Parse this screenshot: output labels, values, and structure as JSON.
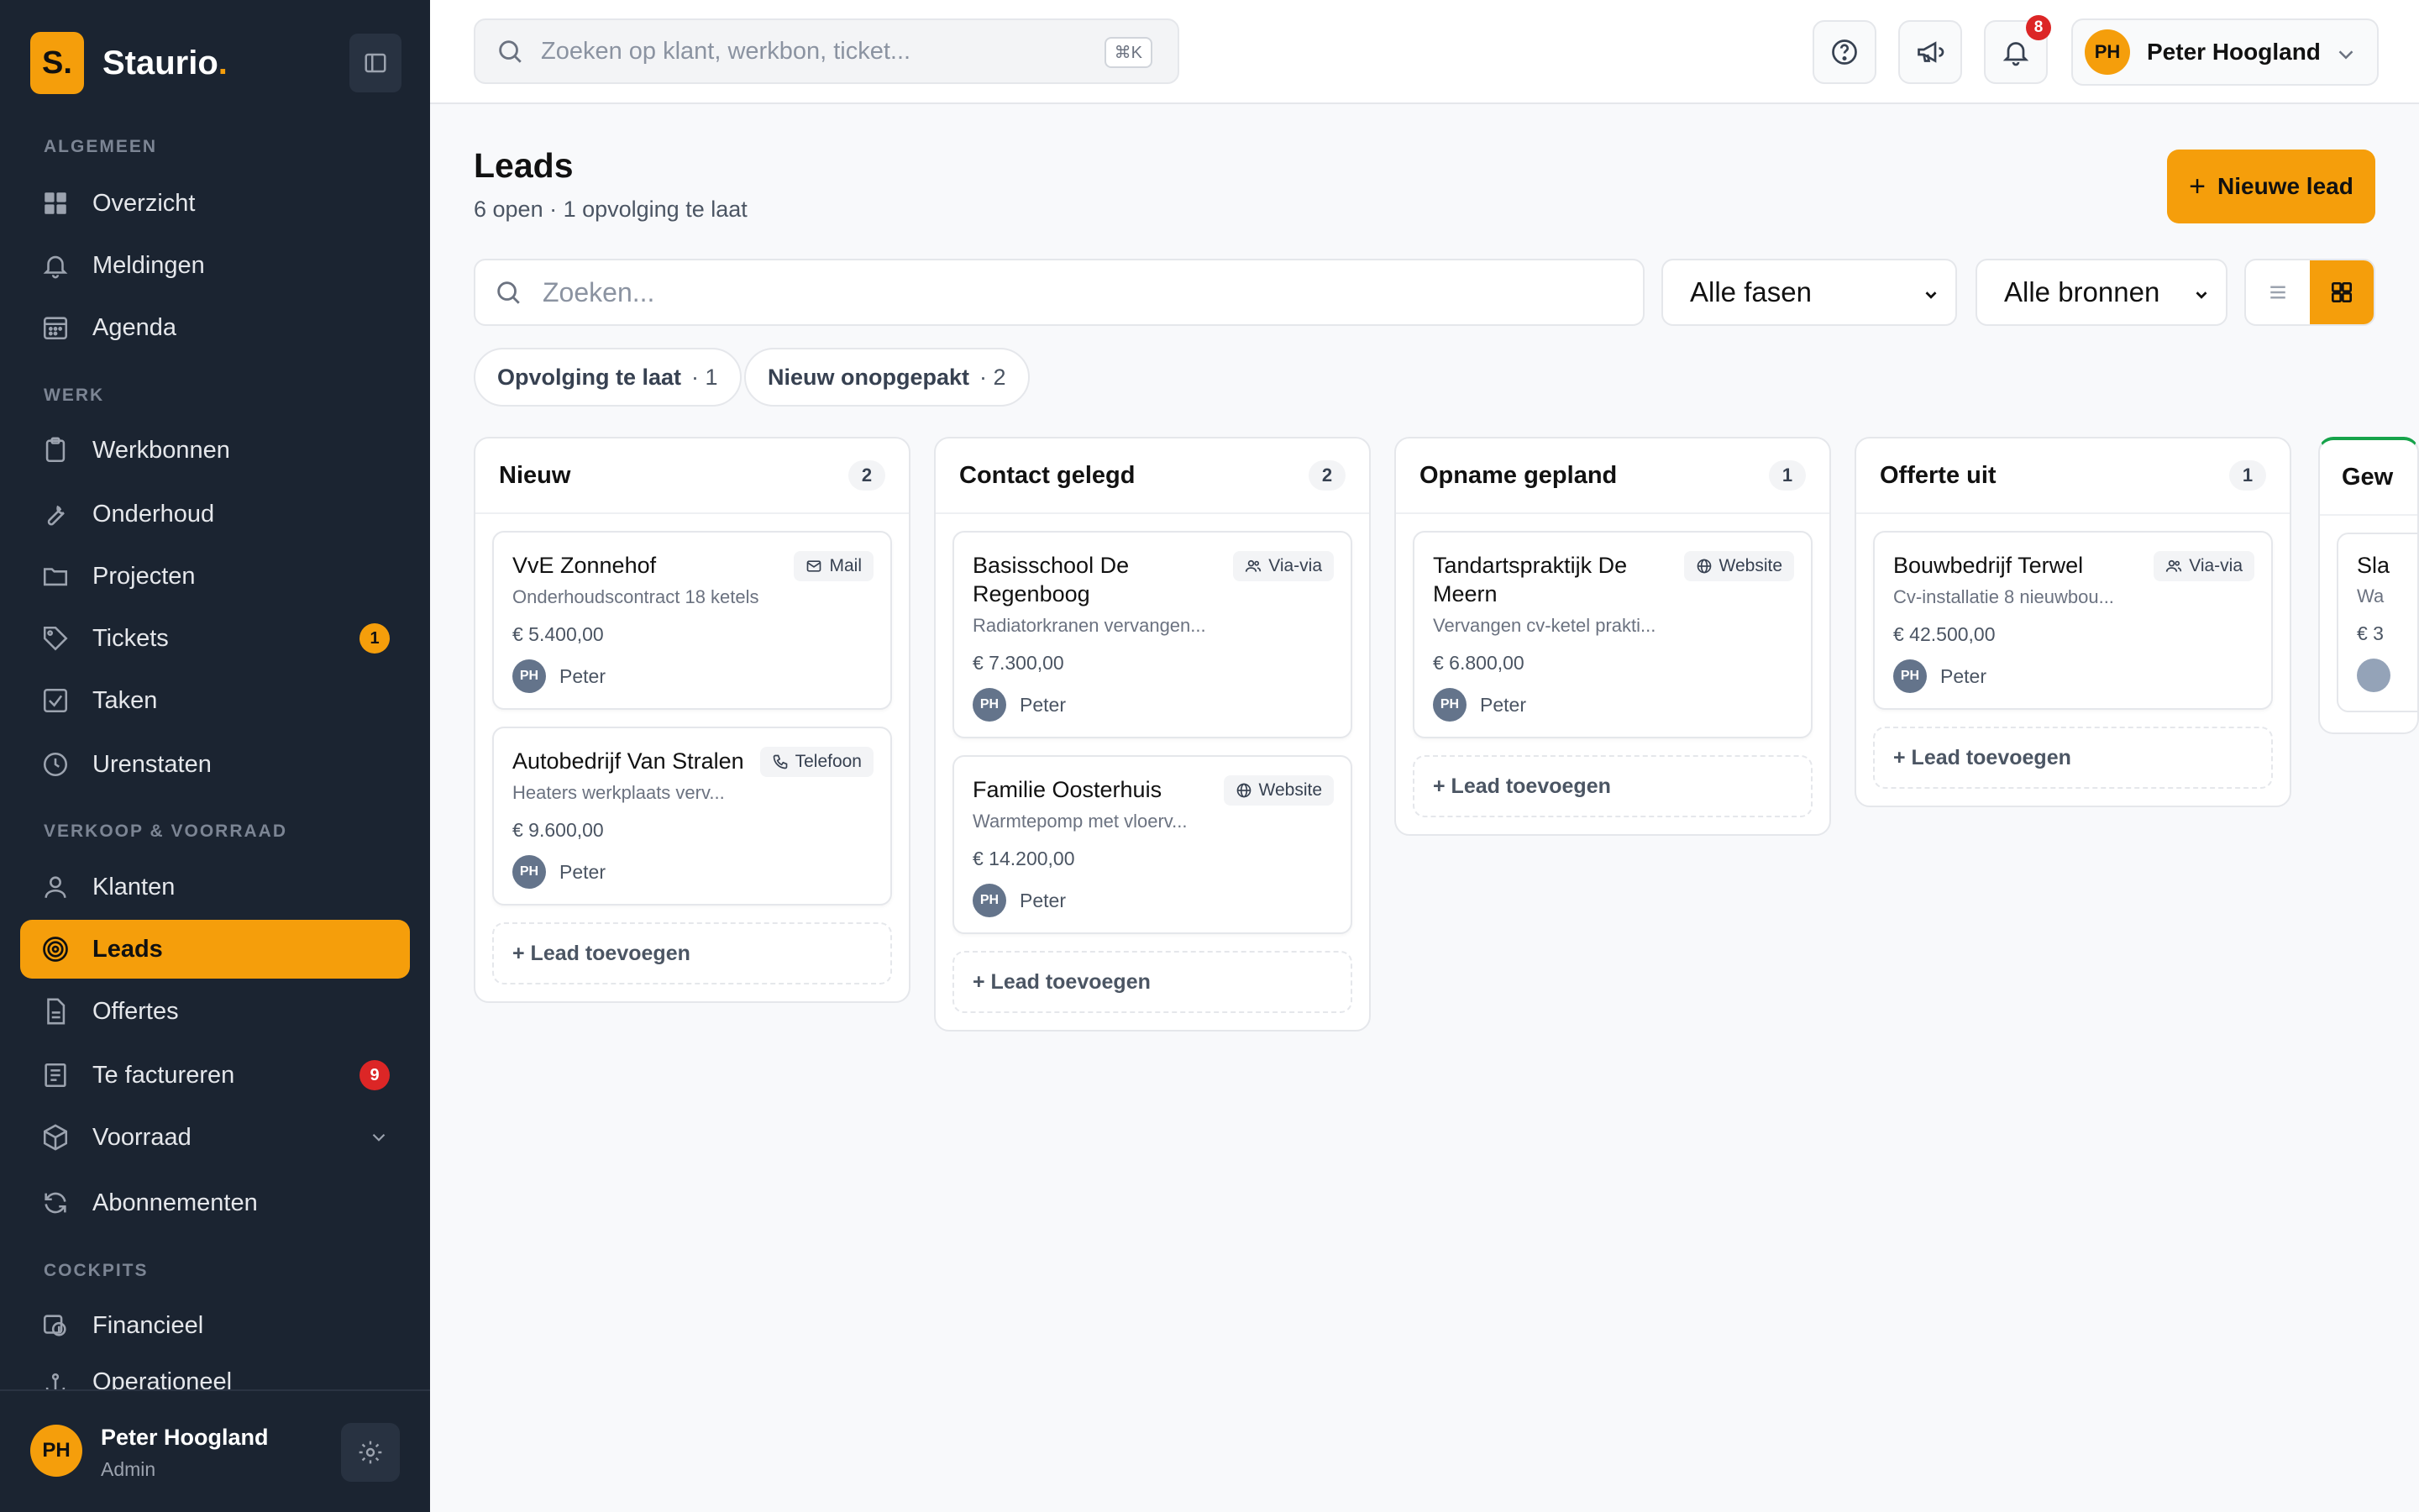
{
  "brand": {
    "logo_letter": "S.",
    "name": "Staurio",
    "dot": "."
  },
  "sidebar": {
    "sections": [
      "ALGEMEEN",
      "WERK",
      "VERKOOP & VOORRAAD",
      "COCKPITS"
    ],
    "items": [
      {
        "label": "Overzicht"
      },
      {
        "label": "Meldingen"
      },
      {
        "label": "Agenda"
      },
      {
        "label": "Werkbonnen"
      },
      {
        "label": "Onderhoud"
      },
      {
        "label": "Projecten"
      },
      {
        "label": "Tickets",
        "badge": "1"
      },
      {
        "label": "Taken"
      },
      {
        "label": "Urenstaten"
      },
      {
        "label": "Klanten"
      },
      {
        "label": "Leads"
      },
      {
        "label": "Offertes"
      },
      {
        "label": "Te factureren",
        "badge": "9"
      },
      {
        "label": "Voorraad"
      },
      {
        "label": "Abonnementen"
      },
      {
        "label": "Financieel"
      },
      {
        "label": "Operationeel"
      }
    ],
    "footer": {
      "initials": "PH",
      "name": "Peter Hoogland",
      "role": "Admin"
    }
  },
  "topbar": {
    "search_placeholder": "Zoeken op klant, werkbon, ticket...",
    "shortcut": "⌘K",
    "notifications_count": "8",
    "user_initials": "PH",
    "user_name": "Peter Hoogland"
  },
  "page": {
    "title": "Leads",
    "subtitle": "6 open · 1 opvolging te laat",
    "new_button": "Nieuwe lead",
    "search_placeholder": "Zoeken...",
    "phase_filter": "Alle fasen",
    "source_filter": "Alle bronnen",
    "chips": [
      {
        "label": "Opvolging te laat",
        "count": "· 1"
      },
      {
        "label": "Nieuw onopgepakt",
        "count": "· 2"
      }
    ]
  },
  "board": {
    "add_label": "+ Lead toevoegen",
    "columns": [
      {
        "title": "Nieuw",
        "count": "2",
        "cards": [
          {
            "title": "VvE Zonnehof",
            "desc": "Onderhoudscontract 18 ketels",
            "value": "€ 5.400,00",
            "source": "Mail",
            "owner_initials": "PH",
            "owner": "Peter"
          },
          {
            "title": "Autobedrijf Van Stralen",
            "desc": "Heaters werkplaats verv...",
            "value": "€ 9.600,00",
            "source": "Telefoon",
            "owner_initials": "PH",
            "owner": "Peter"
          }
        ]
      },
      {
        "title": "Contact gelegd",
        "count": "2",
        "cards": [
          {
            "title": "Basisschool De Regenboog",
            "desc": "Radiatorkranen vervangen...",
            "value": "€ 7.300,00",
            "source": "Via-via",
            "owner_initials": "PH",
            "owner": "Peter"
          },
          {
            "title": "Familie Oosterhuis",
            "desc": "Warmtepomp met vloerv...",
            "value": "€ 14.200,00",
            "source": "Website",
            "owner_initials": "PH",
            "owner": "Peter"
          }
        ]
      },
      {
        "title": "Opname gepland",
        "count": "1",
        "cards": [
          {
            "title": "Tandartspraktijk De Meern",
            "desc": "Vervangen cv-ketel prakti...",
            "value": "€ 6.800,00",
            "source": "Website",
            "owner_initials": "PH",
            "owner": "Peter"
          }
        ]
      },
      {
        "title": "Offerte uit",
        "count": "1",
        "cards": [
          {
            "title": "Bouwbedrijf Terwel",
            "desc": "Cv-installatie 8 nieuwbou...",
            "value": "€ 42.500,00",
            "source": "Via-via",
            "owner_initials": "PH",
            "owner": "Peter"
          }
        ]
      }
    ],
    "peek": {
      "title": "Gew",
      "card_title": "Sla",
      "card_desc": "Wa",
      "card_value": "€ 3"
    }
  },
  "colors": {
    "accent": "#f59e0b",
    "sidebar_bg": "#1b2431",
    "badge_red": "#dc2626",
    "won_green": "#16a34a"
  }
}
